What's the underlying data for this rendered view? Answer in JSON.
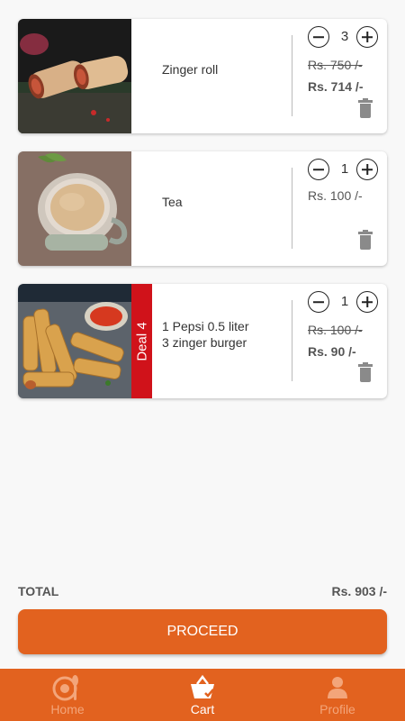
{
  "cart": {
    "items": [
      {
        "name": "Zinger roll",
        "quantity": "3",
        "old_price": "Rs. 750 /-",
        "price": "Rs. 714 /-",
        "image": "zinger-roll-photo"
      },
      {
        "name": "Tea",
        "quantity": "1",
        "price": "Rs. 100 /-",
        "image": "tea-cup-photo"
      },
      {
        "name_line1": "1 Pepsi 0.5 liter",
        "name_line2": "3 zinger burger",
        "deal_tag": "Deal 4",
        "quantity": "1",
        "old_price": "Rs. 100 /-",
        "price": "Rs. 90 /-",
        "image": "spring-rolls-photo"
      }
    ]
  },
  "summary": {
    "total_label": "TOTAL",
    "total_value": "Rs. 903 /-"
  },
  "actions": {
    "proceed_label": "PROCEED"
  },
  "nav": {
    "home_label": "Home",
    "cart_label": "Cart",
    "profile_label": "Profile",
    "active": "Cart"
  },
  "colors": {
    "accent": "#e2621f",
    "deal_tag": "#d0121a",
    "nav_inactive": "#f3a57a"
  },
  "icons": [
    "minus-circle-icon",
    "plus-circle-icon",
    "trash-icon",
    "home-icon",
    "cart-icon",
    "profile-icon"
  ]
}
